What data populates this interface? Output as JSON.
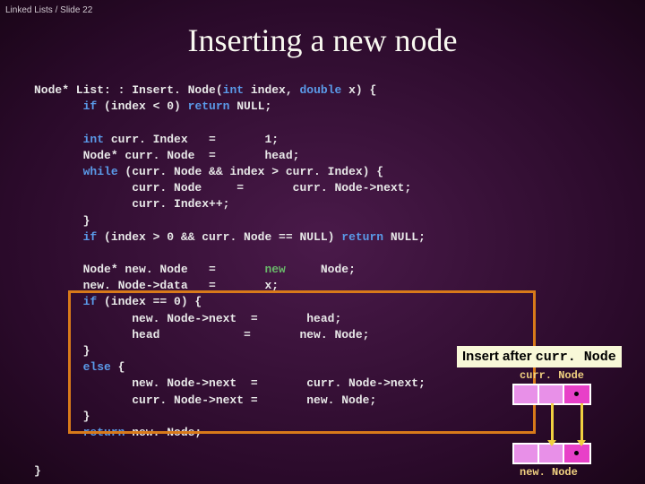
{
  "breadcrumb": "Linked Lists / Slide 22",
  "title": "Inserting a new node",
  "code": {
    "l1a": "Node* List: : Insert. Node(",
    "l1b": "int",
    "l1c": " index, ",
    "l1d": "double",
    "l1e": " x) {",
    "l2a": "       if",
    "l2b": " (index < 0) ",
    "l2c": "return",
    "l2d": " NULL;",
    "l3a": "       int",
    "l3b": " curr. Index   =       1;",
    "l4": "       Node* curr. Node  =       head;",
    "l5a": "       while",
    "l5b": " (curr. Node && index > curr. Index) {",
    "l6": "              curr. Node     =       curr. Node->next;",
    "l7": "              curr. Index++;",
    "l8": "       }",
    "l9a": "       if",
    "l9b": " (index > 0 && curr. Node == NULL) ",
    "l9c": "return",
    "l9d": " NULL;",
    "l10a": "       Node* new. Node   =       ",
    "l10b": "new",
    "l10c": "     Node;",
    "l11": "       new. Node->data   =       x;",
    "l12a": "       if",
    "l12b": " (index == 0) {",
    "l13": "              new. Node->next  =       head;",
    "l14": "              head            =       new. Node;",
    "l15": "       }",
    "l16a": "       else",
    "l16b": " {",
    "l17": "              new. Node->next  =       curr. Node->next;",
    "l18": "              curr. Node->next =       new. Node;",
    "l19": "       }",
    "l20a": "       return",
    "l20b": " new. Node;"
  },
  "annotation_prefix": "Insert after ",
  "annotation_code": "curr. Node",
  "label_curr": "curr. Node",
  "label_new": "new. Node",
  "closing": "}"
}
